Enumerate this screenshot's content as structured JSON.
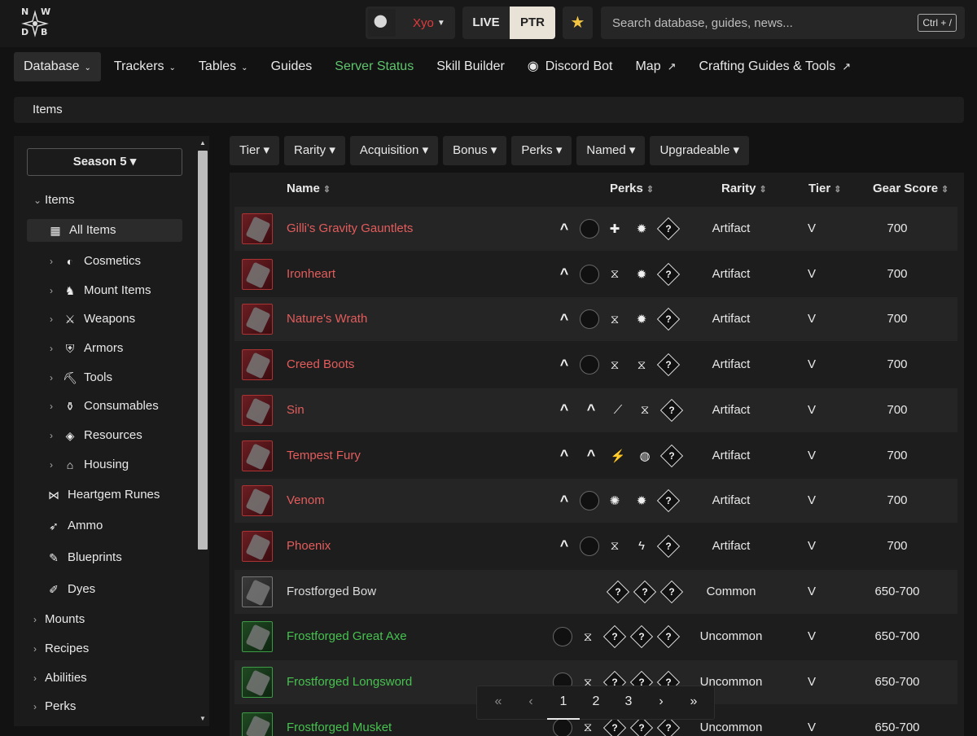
{
  "logo": {
    "n": "N",
    "w": "W",
    "d": "D",
    "b": "B"
  },
  "user": {
    "name": "Xyo"
  },
  "env": {
    "live": "LIVE",
    "ptr": "PTR"
  },
  "search": {
    "placeholder": "Search database, guides, news...",
    "shortcut": "Ctrl + /"
  },
  "nav": [
    {
      "label": "Database",
      "dropdown": true
    },
    {
      "label": "Trackers",
      "dropdown": true
    },
    {
      "label": "Tables",
      "dropdown": true
    },
    {
      "label": "Guides"
    },
    {
      "label": "Server Status"
    },
    {
      "label": "Skill Builder"
    },
    {
      "label": "Discord Bot"
    },
    {
      "label": "Map"
    },
    {
      "label": "Crafting Guides & Tools"
    }
  ],
  "breadcrumb": "Items",
  "sidebar": {
    "season": "Season 5 ▾",
    "items": [
      {
        "label": "Items"
      },
      {
        "label": "All Items"
      },
      {
        "label": "Cosmetics"
      },
      {
        "label": "Mount Items"
      },
      {
        "label": "Weapons"
      },
      {
        "label": "Armors"
      },
      {
        "label": "Tools"
      },
      {
        "label": "Consumables"
      },
      {
        "label": "Resources"
      },
      {
        "label": "Housing"
      },
      {
        "label": "Heartgem Runes"
      },
      {
        "label": "Ammo"
      },
      {
        "label": "Blueprints"
      },
      {
        "label": "Dyes"
      },
      {
        "label": "Mounts"
      },
      {
        "label": "Recipes"
      },
      {
        "label": "Abilities"
      },
      {
        "label": "Perks"
      }
    ]
  },
  "filters": [
    "Tier ▾",
    "Rarity ▾",
    "Acquisition ▾",
    "Bonus ▾",
    "Perks ▾",
    "Named ▾",
    "Upgradeable ▾"
  ],
  "columns": {
    "name": "Name",
    "perks": "Perks",
    "rarity": "Rarity",
    "tier": "Tier",
    "gear_score": "Gear Score"
  },
  "rows": [
    {
      "name": "Gilli's Gravity Gauntlets",
      "rarity": "Artifact",
      "tier": "V",
      "gs": "700",
      "perks": [
        "up",
        "circle",
        "✚",
        "✹",
        "?"
      ]
    },
    {
      "name": "Ironheart",
      "rarity": "Artifact",
      "tier": "V",
      "gs": "700",
      "perks": [
        "up",
        "circle",
        "⧖",
        "✹",
        "?"
      ]
    },
    {
      "name": "Nature's Wrath",
      "rarity": "Artifact",
      "tier": "V",
      "gs": "700",
      "perks": [
        "up",
        "circle",
        "⧖",
        "✹",
        "?"
      ]
    },
    {
      "name": "Creed Boots",
      "rarity": "Artifact",
      "tier": "V",
      "gs": "700",
      "perks": [
        "up",
        "circle",
        "⧖",
        "⧖",
        "?"
      ]
    },
    {
      "name": "Sin",
      "rarity": "Artifact",
      "tier": "V",
      "gs": "700",
      "perks": [
        "up",
        "up",
        "⟋",
        "⧖",
        "?"
      ]
    },
    {
      "name": "Tempest Fury",
      "rarity": "Artifact",
      "tier": "V",
      "gs": "700",
      "perks": [
        "up",
        "up",
        "⚡",
        "◍",
        "?"
      ]
    },
    {
      "name": "Venom",
      "rarity": "Artifact",
      "tier": "V",
      "gs": "700",
      "perks": [
        "up",
        "circle",
        "✺",
        "✹",
        "?"
      ]
    },
    {
      "name": "Phoenix",
      "rarity": "Artifact",
      "tier": "V",
      "gs": "700",
      "perks": [
        "up",
        "circle",
        "⧖",
        "ϟ",
        "?"
      ]
    },
    {
      "name": "Frostforged Bow",
      "rarity": "Common",
      "tier": "V",
      "gs": "650-700",
      "perks": [
        "?",
        "?",
        "?"
      ]
    },
    {
      "name": "Frostforged Great Axe",
      "rarity": "Uncommon",
      "tier": "V",
      "gs": "650-700",
      "perks": [
        "circle",
        "⧖",
        "?",
        "?",
        "?"
      ]
    },
    {
      "name": "Frostforged Longsword",
      "rarity": "Uncommon",
      "tier": "V",
      "gs": "650-700",
      "perks": [
        "circle",
        "⧖",
        "?",
        "?",
        "?"
      ]
    },
    {
      "name": "Frostforged Musket",
      "rarity": "Uncommon",
      "tier": "V",
      "gs": "650-700",
      "perks": [
        "circle",
        "⧖",
        "?",
        "?",
        "?"
      ]
    }
  ],
  "pager": {
    "first": "«",
    "prev": "‹",
    "pages": [
      "1",
      "2",
      "3"
    ],
    "next": "›",
    "last": "»"
  }
}
